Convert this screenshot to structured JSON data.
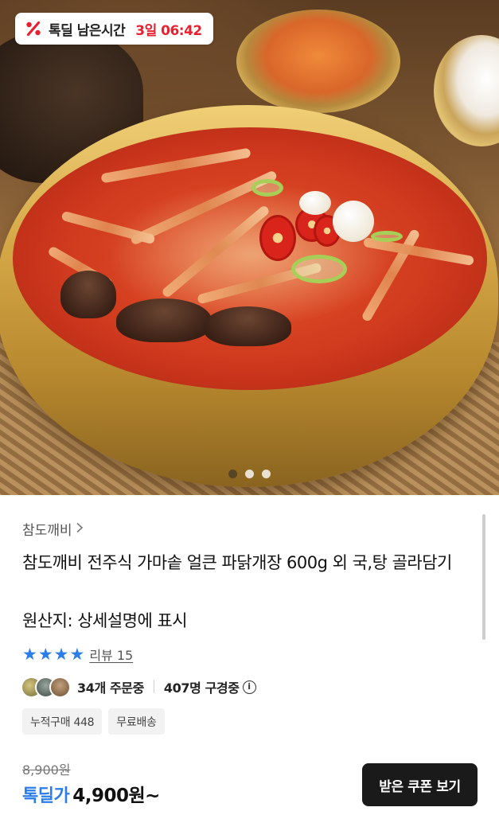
{
  "hero": {
    "timer_label": "톡딜 남은시간",
    "timer_value": "3일 06:42",
    "pager_count": 3,
    "pager_active_index": 0
  },
  "product": {
    "brand": "참도깨비",
    "title": "참도깨비 전주식 가마솥 얼큰 파닭개장 600g 외 국,탕 골라담기",
    "origin": "원산지: 상세설명에 표시",
    "rating_stars": 4,
    "review_label": "리뷰 15",
    "orders": "34개 주문중",
    "viewers": "407명 구경중",
    "tags": [
      "누적구매 448",
      "무료배송"
    ],
    "original_price": "8,900원",
    "deal_label": "톡딜가",
    "deal_price": "4,900원~",
    "coupon_button": "받은 쿠폰 보기"
  },
  "colors": {
    "accent_blue": "#2b7de9",
    "timer_red": "#e8202f",
    "button_dark": "#1a1a1a"
  },
  "icons": {
    "timer": "percent-badge-icon",
    "star": "star-icon",
    "info": "info-circle-icon",
    "chevron": "chevron-right-icon"
  }
}
